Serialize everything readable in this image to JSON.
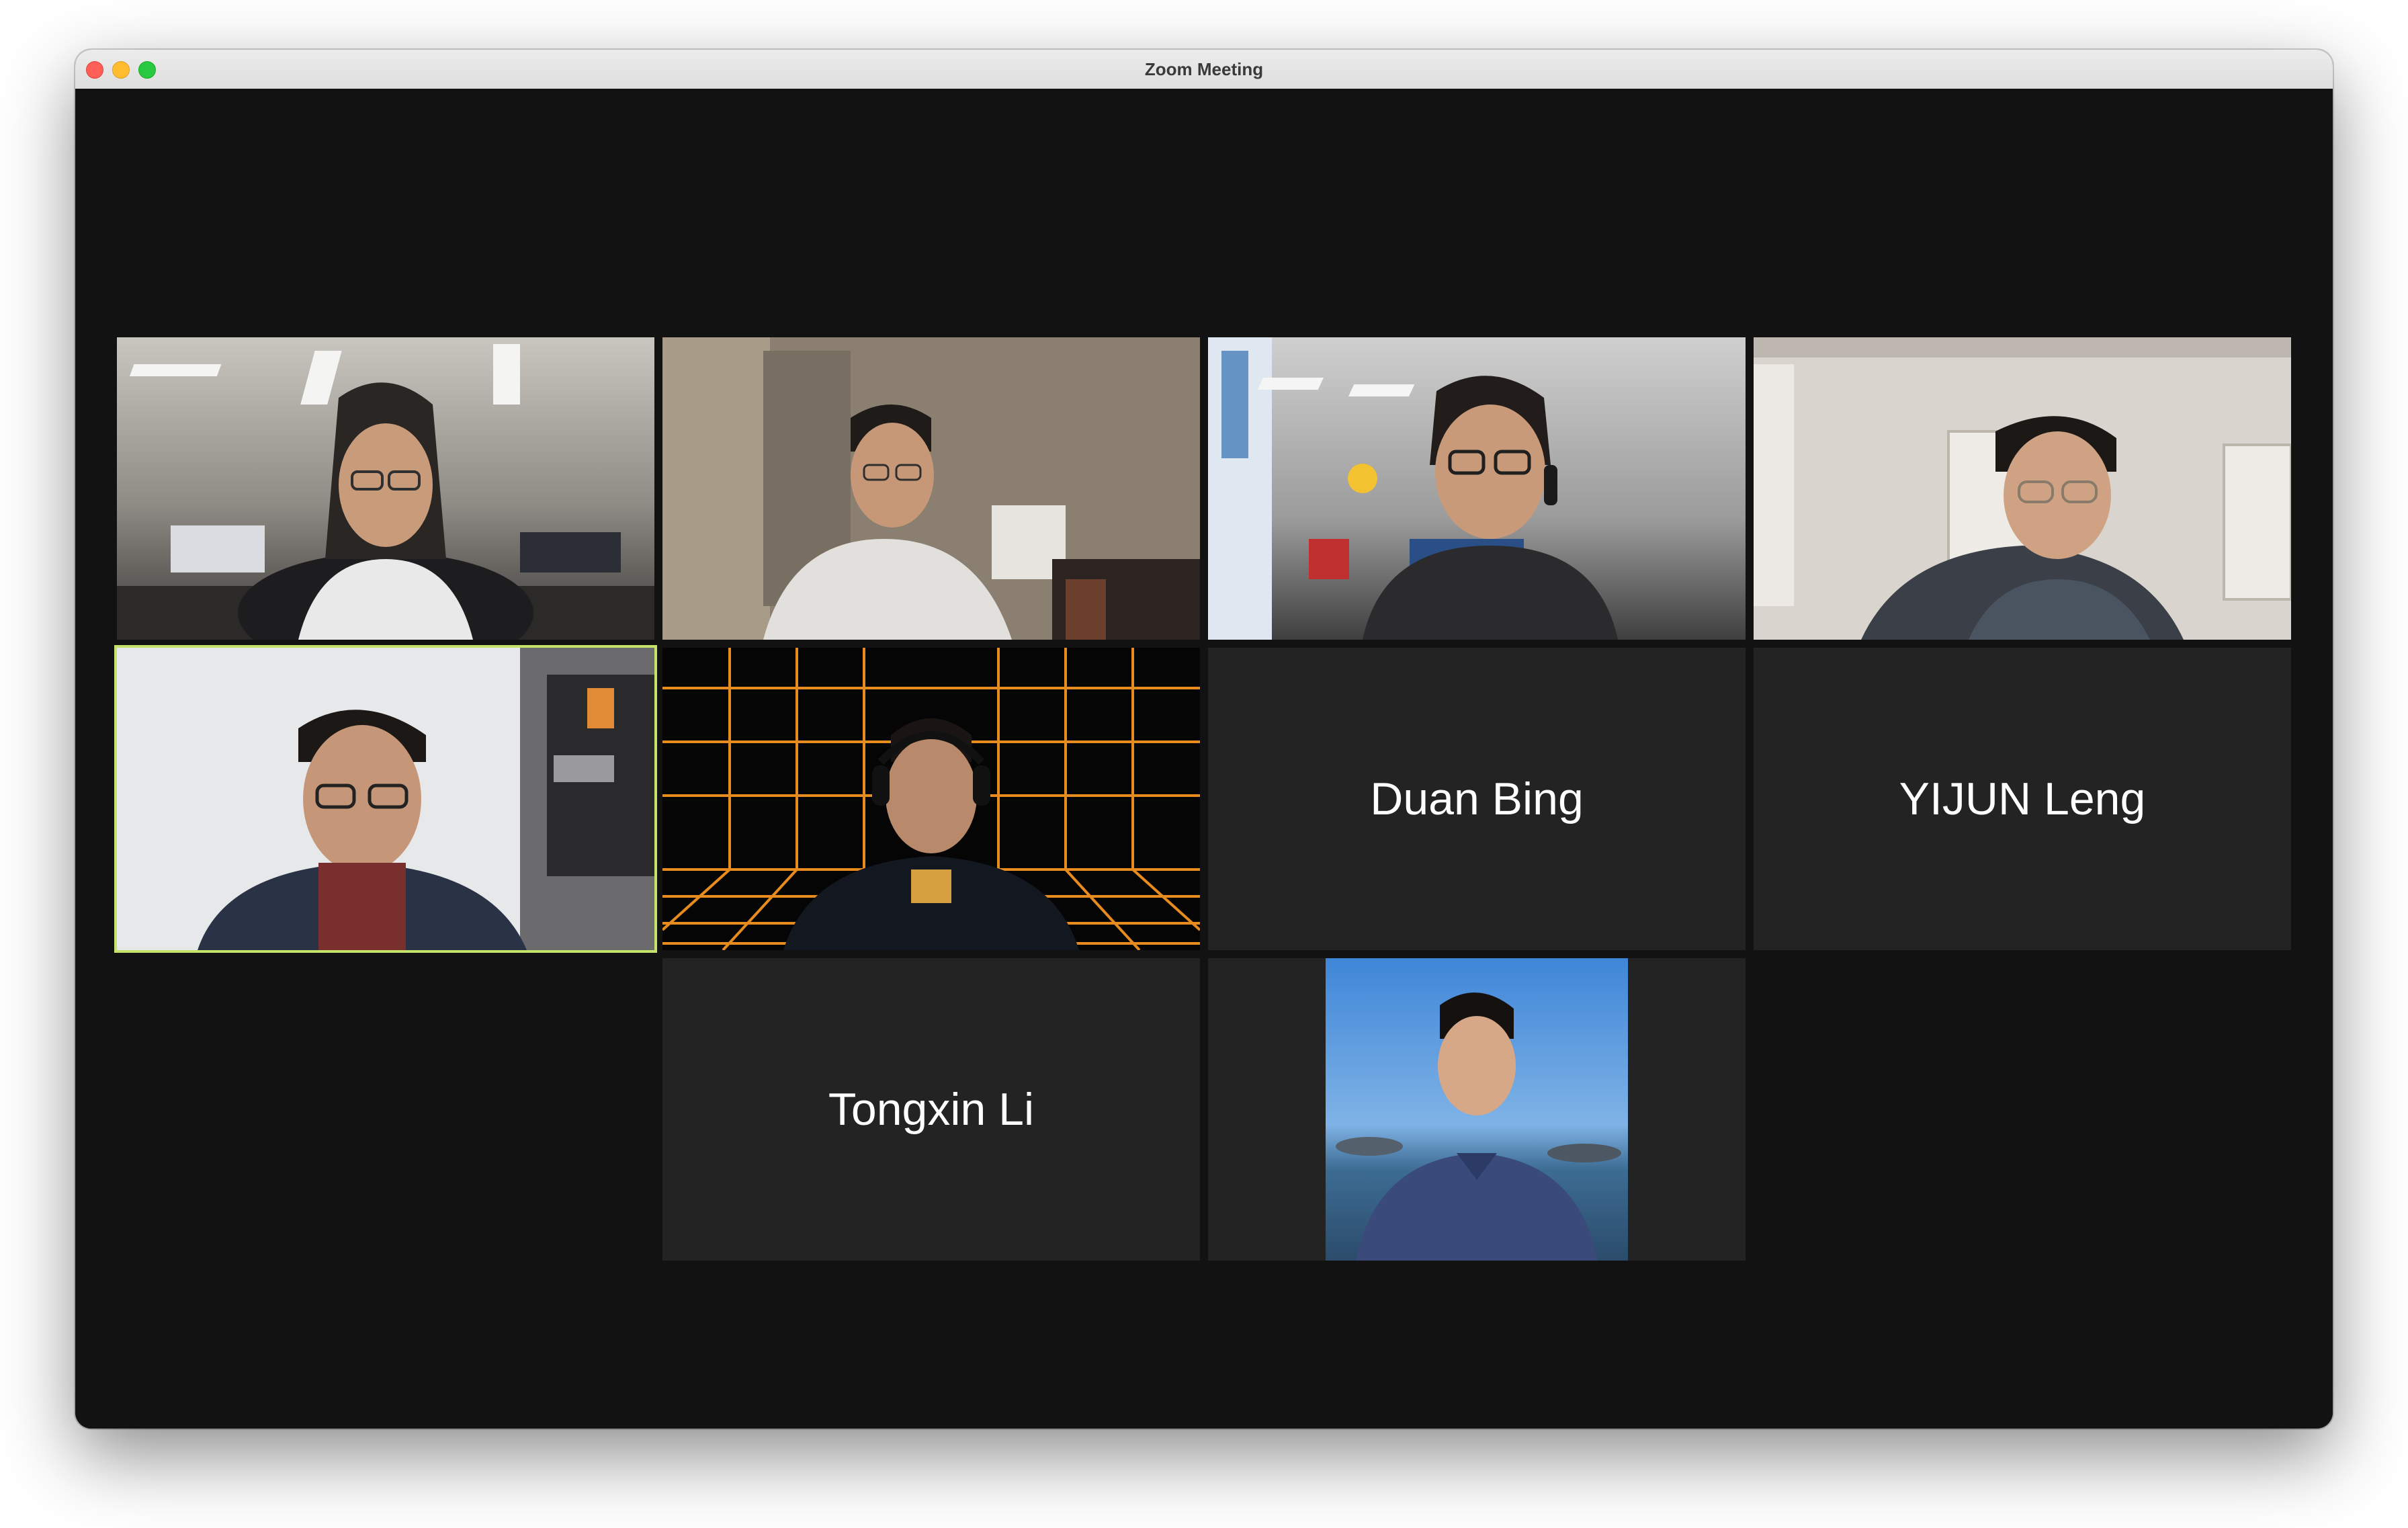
{
  "window": {
    "title": "Zoom Meeting"
  },
  "colors": {
    "window_bg": "#121212",
    "tile_bg": "#232323",
    "active_speaker_border": "#c5e36b",
    "name_text": "#ffffff"
  },
  "participants": [
    {
      "name": "",
      "video": "on",
      "scene": "open office",
      "active_speaker": false
    },
    {
      "name": "",
      "video": "on",
      "scene": "home room",
      "active_speaker": false
    },
    {
      "name": "",
      "video": "on",
      "scene": "open office with headset",
      "active_speaker": false
    },
    {
      "name": "",
      "video": "on",
      "scene": "home room",
      "active_speaker": false
    },
    {
      "name": "",
      "video": "on",
      "scene": "whiteboard office",
      "active_speaker": true
    },
    {
      "name": "",
      "video": "on",
      "scene": "orange grid virtual background",
      "active_speaker": false
    },
    {
      "name": "Duan Bing",
      "video": "off",
      "active_speaker": false
    },
    {
      "name": "YIJUN Leng",
      "video": "off",
      "active_speaker": false
    },
    {
      "name": "Tongxin Li",
      "video": "off",
      "active_speaker": false
    },
    {
      "name": "",
      "video": "profile photo",
      "scene": "seaside portrait",
      "active_speaker": false
    }
  ]
}
